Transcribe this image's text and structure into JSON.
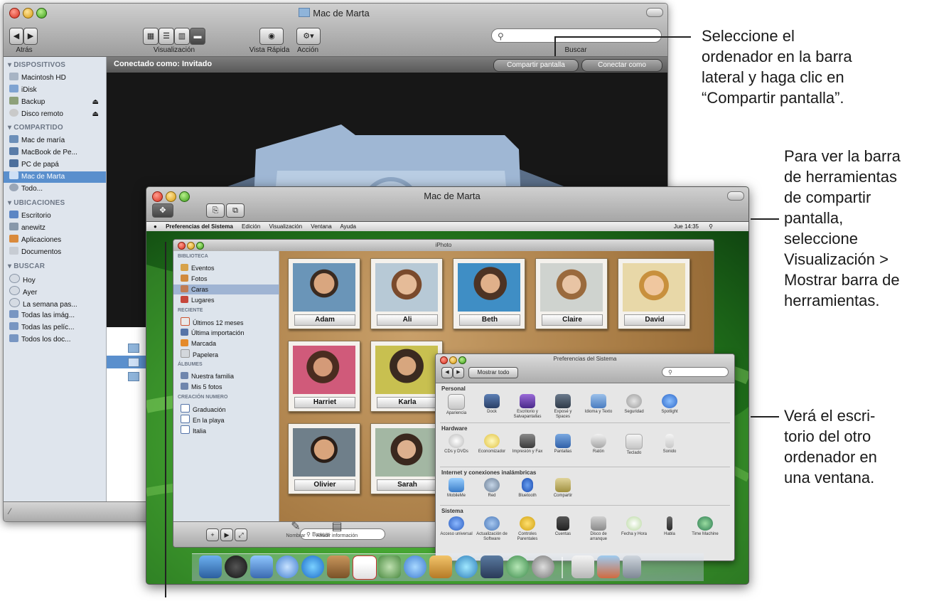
{
  "finder": {
    "title": "Mac de Marta",
    "nav_label": "Atrás",
    "view_label": "Visualización",
    "quicklook_label": "Vista Rápida",
    "action_label": "Acción",
    "search_label": "Buscar",
    "connected_text": "Conectado como: Invitado",
    "share_screen_button": "Compartir pantalla",
    "connect_as_button": "Conectar como",
    "sidebar": {
      "devices_header": "DISPOSITIVOS",
      "devices": [
        "Macintosh HD",
        "iDisk",
        "Backup",
        "Disco remoto"
      ],
      "shared_header": "COMPARTIDO",
      "shared": [
        "Mac de maría",
        "MacBook de Pe...",
        "PC de papá",
        "Mac de Marta",
        "Todo..."
      ],
      "places_header": "UBICACIONES",
      "places": [
        "Escritorio",
        "anewitz",
        "Aplicaciones",
        "Documentos"
      ],
      "search_header": "BUSCAR",
      "search": [
        "Hoy",
        "Ayer",
        "La semana pas...",
        "Todas las imág...",
        "Todas las pelíc...",
        "Todos los doc..."
      ]
    }
  },
  "screenshare": {
    "title": "Mac de Marta",
    "menubar": [
      "Preferencias del Sistema",
      "Edición",
      "Visualización",
      "Ventana",
      "Ayuda"
    ],
    "menubar_clock": "Jue 14:35",
    "iphoto": {
      "title": "iPhoto",
      "library_header": "BIBLIOTECA",
      "library": [
        "Eventos",
        "Fotos",
        "Caras",
        "Lugares"
      ],
      "recent_header": "RECIENTE",
      "recent": [
        "Últimos 12 meses",
        "Última importación",
        "Marcada",
        "Papelera"
      ],
      "albums_header": "ÁLBUMES",
      "albums": [
        "Nuestra familia",
        "Mis 5 fotos"
      ],
      "slides_header": "CREACIÓN NUMERO",
      "slides": [
        "Graduación",
        "En la playa",
        "Italia"
      ],
      "faces": [
        "Adam",
        "Ali",
        "Beth",
        "Claire",
        "David",
        "Harriet",
        "Karla",
        "Olivier",
        "Sarah"
      ],
      "bottom_labels": [
        "Nombrar",
        "Añadir información"
      ],
      "search_placeholder": "Buscar"
    },
    "prefs": {
      "title": "Preferencias del Sistema",
      "show_all_button": "Mostrar todo",
      "sections": {
        "personal": {
          "title": "Personal",
          "items": [
            "Apariencia",
            "Dock",
            "Escritorio y Salvapantallas",
            "Exposé y Spaces",
            "Idioma y Texto",
            "Seguridad",
            "Spotlight"
          ]
        },
        "hardware": {
          "title": "Hardware",
          "items": [
            "CDs y DVDs",
            "Economizador",
            "Impresión y Fax",
            "Pantallas",
            "Ratón",
            "Teclado",
            "Sonido"
          ]
        },
        "internet": {
          "title": "Internet y conexiones inalámbricas",
          "items": [
            "MobileMe",
            "Red",
            "Bluetooth",
            "Compartir"
          ]
        },
        "system": {
          "title": "Sistema",
          "items": [
            "Acceso universal",
            "Actualización de Software",
            "Controles Parentales",
            "Cuentas",
            "Disco de arranque",
            "Fecha y Hora",
            "Habla",
            "Time Machine"
          ]
        }
      }
    }
  },
  "annotations": {
    "a1": [
      "Seleccione el",
      "ordenador en la barra",
      "lateral y haga clic en",
      "“Compartir pantalla”."
    ],
    "a2": [
      "Para ver la barra",
      "de herramientas",
      "de compartir",
      "pantalla,",
      "seleccione",
      "Visualización >",
      "Mostrar barra de",
      "herramientas."
    ],
    "a3": [
      "Verá el escri-",
      "torio del otro",
      "ordenador en",
      "una ventana."
    ]
  },
  "colors": {
    "selection": "#5a8fcd",
    "desktop": "#3d9d2c",
    "cork": "#a87c45"
  }
}
